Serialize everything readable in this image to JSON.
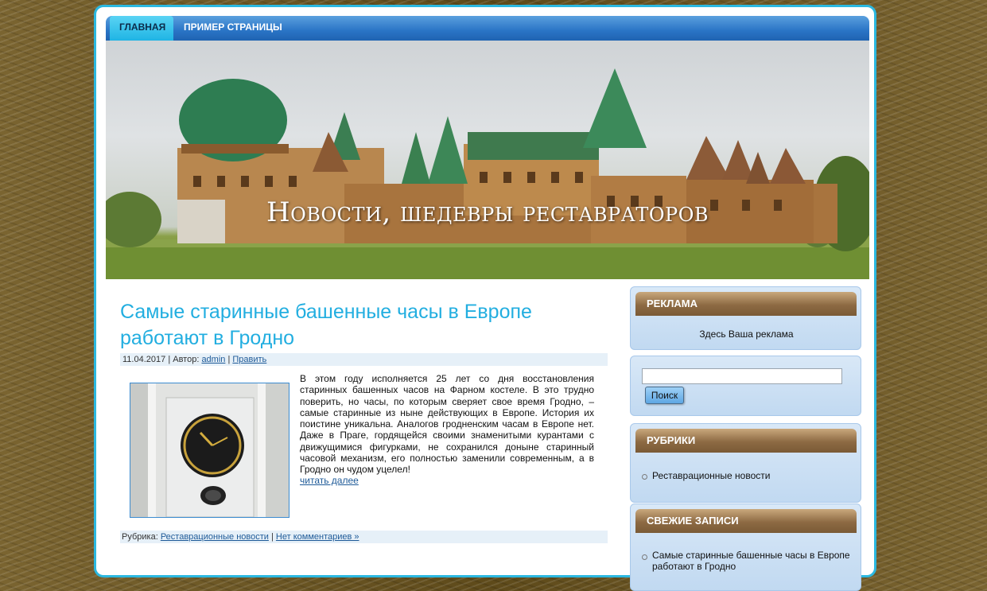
{
  "nav": {
    "items": [
      "ГЛАВНАЯ",
      "ПРИМЕР СТРАНИЦЫ"
    ]
  },
  "header": {
    "title": "Новости, шедевры реставраторов"
  },
  "post": {
    "title": "Самые старинные башенные часы в Европе работают в Гродно",
    "date": "11.04.2017",
    "author_label": "| Автор:",
    "author": "admin",
    "edit": "Править",
    "text": "В этом году исполняется 25 лет со дня восстановления старинных башенных часов на Фарном костеле. В это трудно поверить, но часы, по которым сверяет свое время Гродно, – самые старинные из ныне действующих в Европе. История их поистине уникальна. Аналогов гродненским часам в Европе нет. Даже в Праге, гордящейся своими знаменитыми курантами с движущимися фигурками, не сохранился доныне старинный часовой механизм, его полностью заменили современным, а в Гродно он чудом уцелел!",
    "read_more": "читать далее",
    "category_label": "Рубрика:",
    "category": "Реставрационные новости",
    "comments": "Нет комментариев »"
  },
  "sidebar": {
    "ads": {
      "title": "РЕКЛАМА",
      "text": "Здесь Ваша реклама"
    },
    "search": {
      "value": "",
      "button": "Поиск"
    },
    "categories": {
      "title": "РУБРИКИ",
      "items": [
        "Реставрационные новости"
      ]
    },
    "recent": {
      "title": "СВЕЖИЕ ЗАПИСИ",
      "items": [
        "Самые старинные башенные часы в Европе работают в Гродно"
      ]
    }
  },
  "colors": {
    "accent": "#22aee0",
    "nav": "#2a74c6",
    "widget_head": "#8d6a43"
  }
}
